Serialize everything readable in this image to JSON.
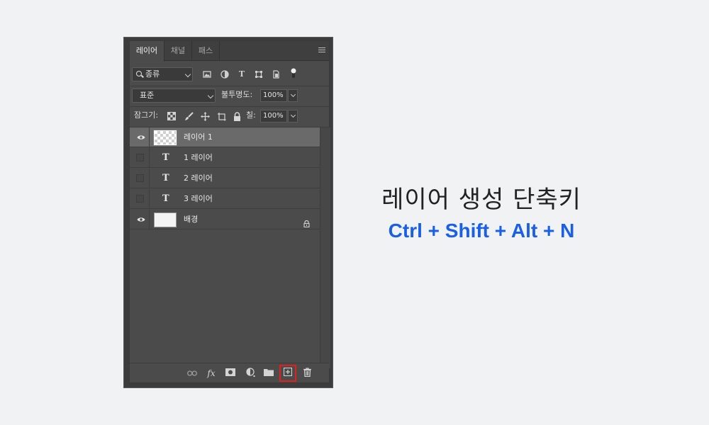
{
  "panel": {
    "tabs": [
      "레이어",
      "채널",
      "패스"
    ],
    "filter": {
      "kind_label": "종류"
    },
    "blend_mode": "표준",
    "opacity_label": "불투명도:",
    "opacity_value": "100%",
    "lock_label": "잠그기:",
    "fill_label": "칠:",
    "fill_value": "100%",
    "layers": [
      {
        "name": "레이어 1",
        "type": "raster",
        "visible": true,
        "selected": true
      },
      {
        "name": "1 레이어",
        "type": "text",
        "visible": false
      },
      {
        "name": "2 레이어",
        "type": "text",
        "visible": false
      },
      {
        "name": "3 레이어",
        "type": "text",
        "visible": false
      },
      {
        "name": "배경",
        "type": "background",
        "visible": true,
        "locked": true
      }
    ],
    "bottom_icons": [
      "link-icon",
      "fx-icon",
      "mask-icon",
      "adjustment-icon",
      "folder-icon",
      "new-layer-icon",
      "trash-icon"
    ],
    "highlight_color": "#e0201f"
  },
  "heading": "레이어 생성 단축키",
  "shortcut": "Ctrl + Shift + Alt + N",
  "shortcut_color": "#1a5fe6"
}
